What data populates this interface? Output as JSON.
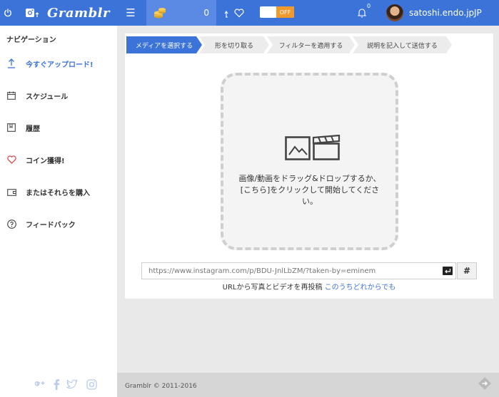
{
  "header": {
    "logo_text": "Gramblr",
    "coin_count": "0",
    "toggle_label": "OFF",
    "notification_count": "0",
    "user_name": "satoshi.endo.jp",
    "language": "JP"
  },
  "sidebar": {
    "title": "ナビゲーション",
    "items": [
      {
        "label": "今すぐアップロード!"
      },
      {
        "label": "スケジュール"
      },
      {
        "label": "履歴"
      },
      {
        "label": "コイン獲得!"
      },
      {
        "label": "またはそれらを購入"
      },
      {
        "label": "フィードバック"
      }
    ]
  },
  "steps": [
    {
      "label": "メディアを選択する"
    },
    {
      "label": "形を切り取る"
    },
    {
      "label": "フィルターを適用する"
    },
    {
      "label": "説明を記入して送信する"
    }
  ],
  "dropzone": {
    "text": "画像/動画をドラッグ&ドロップするか、[こちら]をクリックして開始してください。"
  },
  "url_field": {
    "value": "https://www.instagram.com/p/BDU-JnlLbZM/?taken-by=eminem"
  },
  "hash_button_label": "#",
  "repost": {
    "text": "URLから写真とビデオを再投稿",
    "link": "このうちどれからでも"
  },
  "footer": {
    "copyright": "Gramblr © 2011-2016"
  },
  "colors": {
    "accent": "#3b73d9",
    "toggle_off": "#f09a2e",
    "heart": "#e04b4b"
  }
}
